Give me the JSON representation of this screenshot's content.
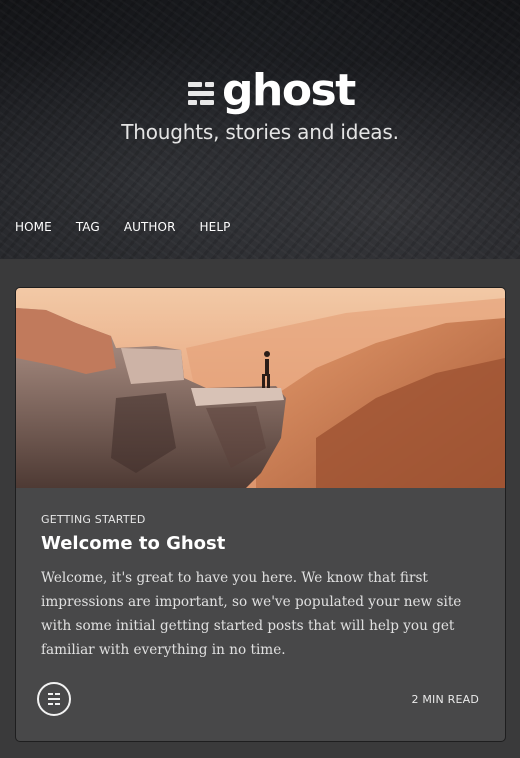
{
  "site": {
    "logo_text": "ghost",
    "tagline": "Thoughts, stories and ideas."
  },
  "nav": {
    "items": [
      {
        "label": "HOME"
      },
      {
        "label": "TAG"
      },
      {
        "label": "AUTHOR"
      },
      {
        "label": "HELP"
      }
    ]
  },
  "post": {
    "tag": "GETTING STARTED",
    "title": "Welcome to Ghost",
    "excerpt": "Welcome, it's great to have you here. We know that first impressions are important, so we've populated your new site with some initial getting started posts that will help you get familiar with everything in no time.",
    "read_time": "2 MIN READ",
    "image_icon": "cliff-landscape-photo",
    "author_icon": "ghost-logo-icon"
  },
  "colors": {
    "page_bg": "#3a3a3b",
    "card_bg": "#484849",
    "header_bg": "#1c1d21"
  }
}
